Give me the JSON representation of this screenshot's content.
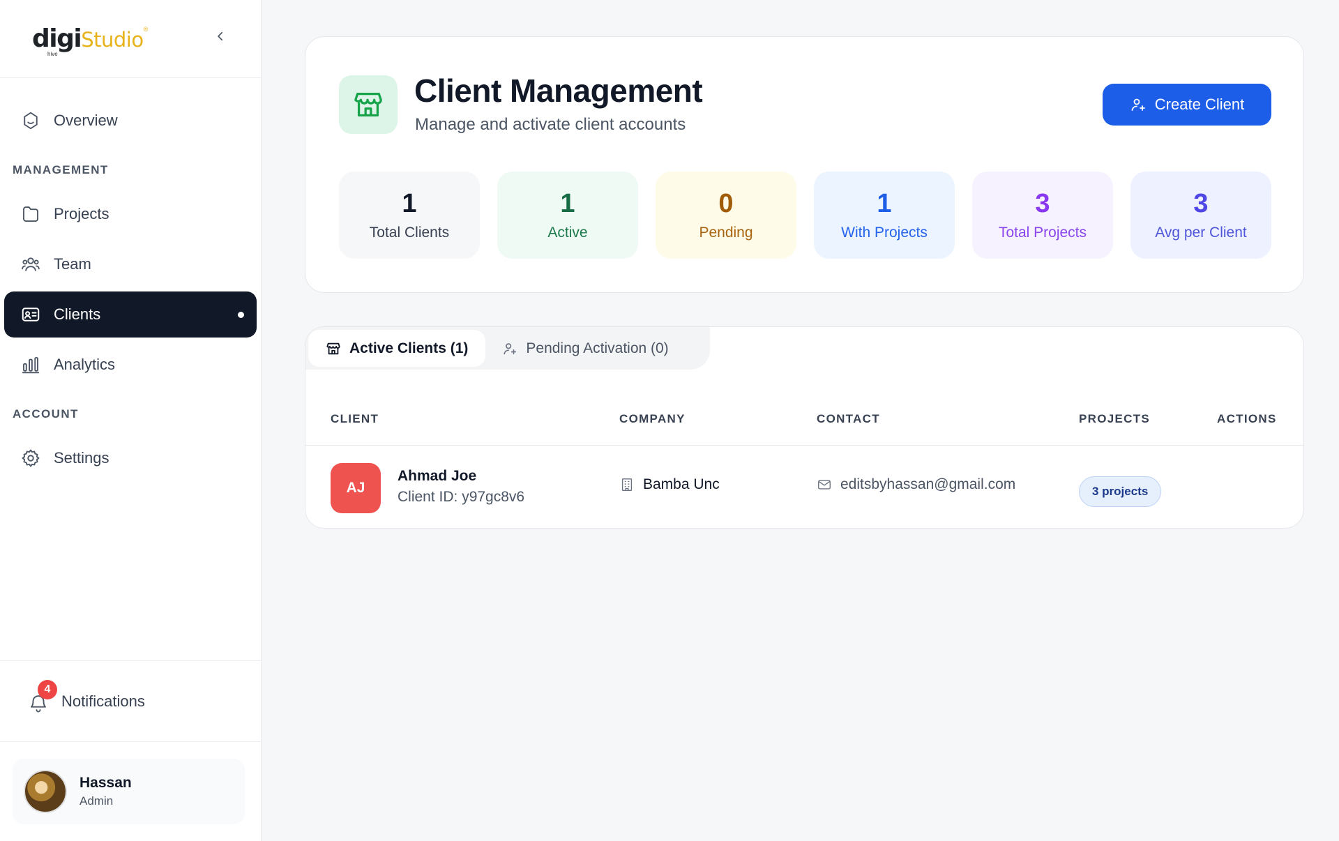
{
  "brand": {
    "digi": "digi",
    "studio": "Studio",
    "reg": "®",
    "hive": "hive"
  },
  "sidebar": {
    "overview": "Overview",
    "section_management": "MANAGEMENT",
    "projects": "Projects",
    "team": "Team",
    "clients": "Clients",
    "analytics": "Analytics",
    "section_account": "ACCOUNT",
    "settings": "Settings",
    "notifications": "Notifications",
    "notification_count": "4",
    "user": {
      "name": "Hassan",
      "role": "Admin"
    }
  },
  "header": {
    "title": "Client Management",
    "subtitle": "Manage and activate client accounts",
    "create_button": "Create Client"
  },
  "stats": [
    {
      "value": "1",
      "label": "Total Clients",
      "bg": "#f6f7f9",
      "value_color": "#111827",
      "label_color": "#374151"
    },
    {
      "value": "1",
      "label": "Active",
      "bg": "#eefaf3",
      "value_color": "#166c45",
      "label_color": "#1c7a4d"
    },
    {
      "value": "0",
      "label": "Pending",
      "bg": "#fefbe8",
      "value_color": "#a15c07",
      "label_color": "#a86410"
    },
    {
      "value": "1",
      "label": "With Projects",
      "bg": "#ebf4ff",
      "value_color": "#1d5ee8",
      "label_color": "#2563eb"
    },
    {
      "value": "3",
      "label": "Total Projects",
      "bg": "#f6f2ff",
      "value_color": "#8a38f0",
      "label_color": "#8b45ec"
    },
    {
      "value": "3",
      "label": "Avg per Client",
      "bg": "#eef1ff",
      "value_color": "#4f46e5",
      "label_color": "#4f56d9"
    }
  ],
  "tabs": {
    "active": "Active Clients (1)",
    "pending": "Pending Activation (0)"
  },
  "table": {
    "columns": [
      "CLIENT",
      "COMPANY",
      "CONTACT",
      "PROJECTS",
      "ACTIONS"
    ],
    "rows": [
      {
        "initials": "AJ",
        "name": "Ahmad Joe",
        "client_id": "Client ID: y97gc8v6",
        "company": "Bamba Unc",
        "email": "editsbyhassan@gmail.com",
        "projects": "3 projects"
      }
    ]
  },
  "colors": {
    "accent": "#1d5ee8",
    "sidebar_active": "#111827",
    "avatar_red": "#ef5350"
  }
}
